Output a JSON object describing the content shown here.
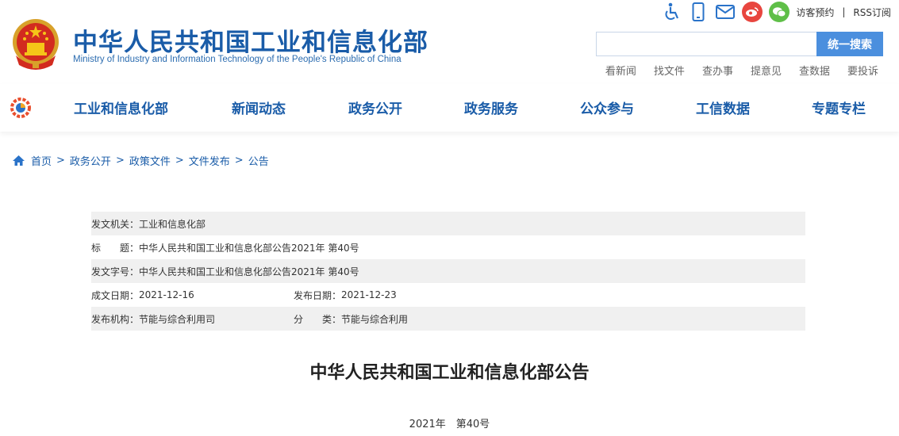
{
  "header": {
    "site_title": "中华人民共和国工业和信息化部",
    "site_subtitle": "Ministry of Industry and Information Technology of the People's Republic of China",
    "emblem_icon": "national-emblem-icon",
    "toolbar": {
      "icons": [
        "accessibility-icon",
        "mobile-icon",
        "mail-icon",
        "weibo-icon",
        "wechat-icon"
      ],
      "visitor_booking": "访客预约",
      "separator": "|",
      "rss": "RSS订阅"
    },
    "search": {
      "placeholder": "",
      "button_label": "统一搜索"
    },
    "quick_links": [
      "看新闻",
      "找文件",
      "查办事",
      "提意见",
      "查数据",
      "要投诉"
    ]
  },
  "nav": {
    "logo_icon": "miit-gear-logo-icon",
    "items": [
      "工业和信息化部",
      "新闻动态",
      "政务公开",
      "政务服务",
      "公众参与",
      "工信数据",
      "专题专栏"
    ]
  },
  "breadcrumb": {
    "home_icon": "home-icon",
    "items": [
      "首页",
      "政务公开",
      "政策文件",
      "文件发布",
      "公告"
    ],
    "separator": ">"
  },
  "info": {
    "issuer_label": "发文机关：",
    "issuer_value": "工业和信息化部",
    "title_label": "标　　题：",
    "title_value": "中华人民共和国工业和信息化部公告2021年 第40号",
    "doc_no_label": "发文字号：",
    "doc_no_value": "中华人民共和国工业和信息化部公告2021年 第40号",
    "written_date_label": "成文日期：",
    "written_date_value": "2021-12-16",
    "publish_date_label": "发布日期：",
    "publish_date_value": "2021-12-23",
    "org_label": "发布机构：",
    "org_value": "节能与综合利用司",
    "category_label": "分　　类：",
    "category_value": "节能与综合利用"
  },
  "document": {
    "title": "中华人民共和国工业和信息化部公告",
    "number": "2021年　第40号"
  },
  "colors": {
    "brand_blue": "#1a5ca8",
    "search_button": "#4b8fde",
    "weibo_red": "#e8463f",
    "wechat_green": "#5fbf48",
    "row_gray": "#f0f0f0"
  }
}
